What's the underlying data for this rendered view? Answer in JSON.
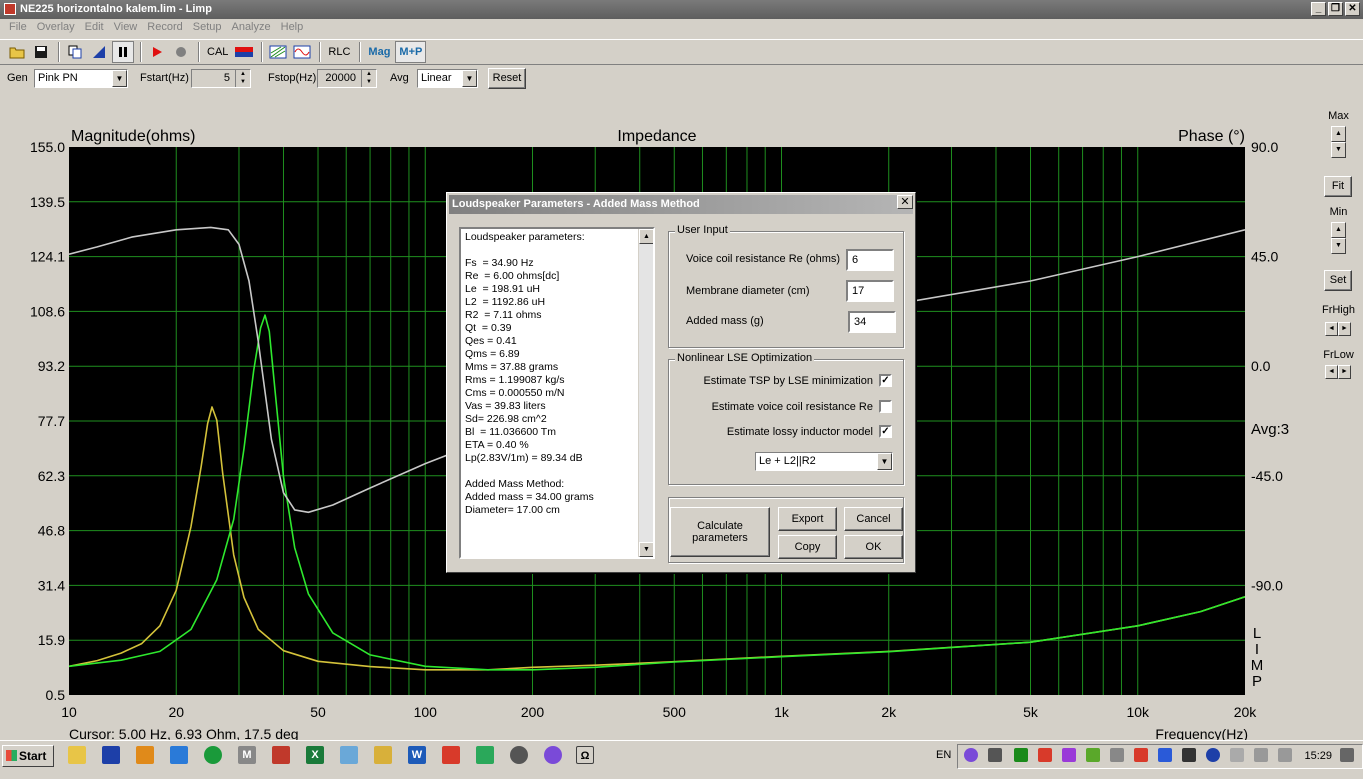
{
  "window": {
    "title": "NE225 horizontalno kalem.lim - Limp"
  },
  "menu": [
    "File",
    "Overlay",
    "Edit",
    "View",
    "Record",
    "Setup",
    "Analyze",
    "Help"
  ],
  "toolbar": {
    "cal_label": "CAL",
    "rlc_label": "RLC",
    "mag_label": "Mag",
    "mp_label": "M+P"
  },
  "gen": {
    "gen_label": "Gen",
    "gen_value": "Pink PN",
    "fstart_label": "Fstart(Hz)",
    "fstart_value": "5",
    "fstop_label": "Fstop(Hz)",
    "fstop_value": "20000",
    "avg_label": "Avg",
    "avg_value": "Linear",
    "reset_label": "Reset"
  },
  "right_panel": {
    "max_label": "Max",
    "fit_label": "Fit",
    "min_label": "Min",
    "set_label": "Set",
    "frhigh_label": "FrHigh",
    "frlow_label": "FrLow"
  },
  "chart_data": {
    "type": "line",
    "title": "Impedance",
    "ylabel": "Magnitude(ohms)",
    "y2label": "Phase (°)",
    "xlabel": "Frequency(Hz)",
    "xscale": "log",
    "xlim": [
      10,
      20000
    ],
    "ylim": [
      0.5,
      155.0
    ],
    "y2lim": [
      -135,
      90
    ],
    "yticks": [
      "155.0",
      "139.5",
      "124.1",
      "108.6",
      "93.2",
      "77.7",
      "62.3",
      "46.8",
      "31.4",
      "15.9",
      "0.5"
    ],
    "y2ticks": [
      "90.0",
      "45.0",
      "0.0",
      "-45.0",
      "-90.0"
    ],
    "xticks": [
      {
        "v": 10,
        "label": "10"
      },
      {
        "v": 20,
        "label": "20"
      },
      {
        "v": 50,
        "label": "50"
      },
      {
        "v": 100,
        "label": "100"
      },
      {
        "v": 200,
        "label": "200"
      },
      {
        "v": 500,
        "label": "500"
      },
      {
        "v": 1000,
        "label": "1k"
      },
      {
        "v": 2000,
        "label": "2k"
      },
      {
        "v": 5000,
        "label": "5k"
      },
      {
        "v": 10000,
        "label": "10k"
      },
      {
        "v": 20000,
        "label": "20k"
      }
    ],
    "avg_text": "Avg:3",
    "cursor_text": "Cursor: 5.00 Hz, 6.93 Ohm, 17.5 deg",
    "limp_text": [
      "L",
      "I",
      "M",
      "P"
    ],
    "grid": true,
    "background": "#000000",
    "series": [
      {
        "axis": "left",
        "color": "#d4c23a",
        "x": [
          10,
          12,
          14,
          16,
          18,
          20,
          22,
          23.5,
          24.5,
          25.2,
          26,
          27,
          29,
          31,
          34,
          40,
          50,
          70,
          100,
          150,
          200,
          300,
          500,
          1000,
          2000,
          5000,
          10000,
          15000,
          20000
        ],
        "y": [
          8.6,
          10.2,
          12.3,
          15.0,
          20.0,
          30.0,
          48.0,
          65.0,
          77.0,
          81.7,
          78.0,
          63.0,
          40.0,
          28.0,
          19.0,
          13.0,
          10.0,
          8.5,
          7.6,
          7.6,
          8.3,
          8.9,
          9.9,
          11.4,
          12.8,
          15.4,
          20.0,
          24.0,
          28.2
        ]
      },
      {
        "axis": "left",
        "color": "#2ee82e",
        "x": [
          10,
          14,
          18,
          22,
          26,
          29,
          31,
          33,
          34.5,
          35.5,
          36.5,
          38,
          40,
          43,
          47,
          55,
          70,
          100,
          150,
          200,
          300,
          500,
          1000,
          2000,
          5000,
          10000,
          15000,
          20000
        ],
        "y": [
          8.6,
          10.3,
          12.8,
          19.0,
          33.0,
          50.0,
          70.0,
          92.0,
          104.0,
          107.6,
          103.0,
          85.0,
          62.0,
          42.0,
          29.0,
          18.0,
          11.8,
          8.6,
          7.6,
          7.6,
          8.3,
          9.8,
          11.3,
          12.7,
          15.4,
          20.0,
          24.0,
          28.2
        ]
      },
      {
        "axis": "right",
        "color": "#c8c8c8",
        "x": [
          10,
          12,
          15,
          20,
          25,
          28,
          30,
          32,
          34,
          37,
          40,
          43,
          47,
          55,
          70,
          100,
          150,
          200,
          300,
          500,
          1000,
          2000,
          5000,
          10000,
          20000
        ],
        "y": [
          46,
          49,
          53,
          56,
          57,
          56,
          50,
          35,
          10,
          -30,
          -52,
          -59,
          -60,
          -57,
          -50,
          -40,
          -30,
          -24,
          -15,
          -5,
          15,
          25,
          35,
          45,
          56
        ]
      }
    ]
  },
  "dialog": {
    "title": "Loudspeaker Parameters - Added Mass Method",
    "params_lines": [
      "Loudspeaker parameters:",
      "",
      "Fs  = 34.90 Hz",
      "Re  = 6.00 ohms[dc]",
      "Le  = 198.91 uH",
      "L2  = 1192.86 uH",
      "R2  = 7.11 ohms",
      "Qt  = 0.39",
      "Qes = 0.41",
      "Qms = 6.89",
      "Mms = 37.88 grams",
      "Rms = 1.199087 kg/s",
      "Cms = 0.000550 m/N",
      "Vas = 39.83 liters",
      "Sd= 226.98 cm^2",
      "Bl  = 11.036600 Tm",
      "ETA = 0.40 %",
      "Lp(2.83V/1m) = 89.34 dB",
      "",
      "Added Mass Method:",
      "Added mass = 34.00 grams",
      "Diameter= 17.00 cm"
    ],
    "user_input": {
      "group_label": "User Input",
      "re_label": "Voice coil resistance Re (ohms)",
      "re_value": "6",
      "diameter_label": "Membrane diameter (cm)",
      "diameter_value": "17",
      "mass_label": "Added mass (g)",
      "mass_value": "34"
    },
    "lse": {
      "group_label": "Nonlinear LSE Optimization",
      "estimate_tsp_label": "Estimate TSP by LSE minimization",
      "estimate_tsp_checked": true,
      "estimate_re_label": "Estimate voice coil resistance Re",
      "estimate_re_checked": false,
      "estimate_lossy_label": "Estimate lossy inductor model",
      "estimate_lossy_checked": true,
      "model_value": "Le + L2||R2"
    },
    "buttons": {
      "calculate": "Calculate parameters",
      "export": "Export",
      "cancel": "Cancel",
      "copy": "Copy",
      "ok": "OK"
    }
  },
  "taskbar": {
    "start_label": "Start",
    "lang": "EN",
    "clock": "15:29"
  }
}
